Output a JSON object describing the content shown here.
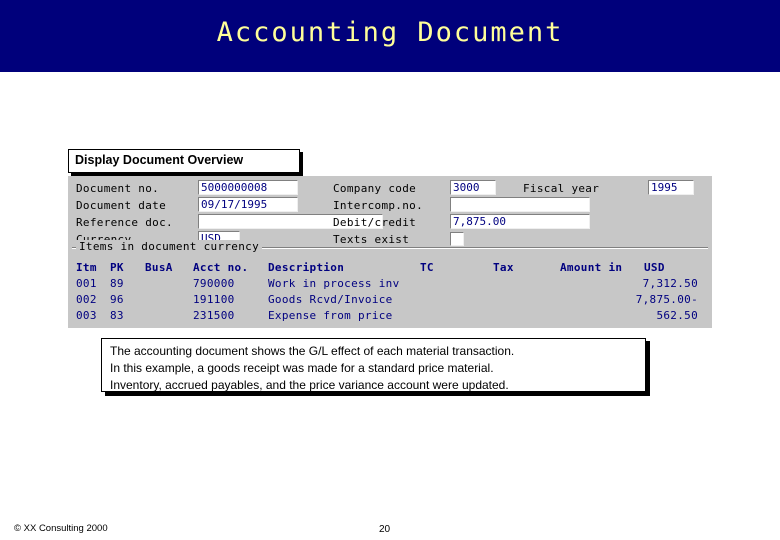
{
  "slide": {
    "title": "Accounting Document",
    "overview_label": "Display Document Overview"
  },
  "sap_screen": {
    "fields": [
      {
        "label": "Document  no.",
        "value": "5000000008"
      },
      {
        "label": "Document  date",
        "value": "09/17/1995"
      },
      {
        "label": "Reference  doc.",
        "value": ""
      },
      {
        "label": "Currency",
        "value": "USD"
      },
      {
        "label": "Company  code",
        "value": "3000"
      },
      {
        "label": "Fiscal  year",
        "value": "1995"
      },
      {
        "label": "Intercomp.no.",
        "value": ""
      },
      {
        "label": "Debit/credit",
        "value": "7,875.00"
      },
      {
        "label": "Texts  exist",
        "value": ""
      }
    ],
    "group_title": "Items  in  document  currency",
    "columns": [
      "Itm",
      "PK",
      "BusA",
      "Acct  no.",
      "Description",
      "TC",
      "Tax",
      "Amount  in",
      "USD"
    ],
    "rows": [
      {
        "itm": "001",
        "pk": "89",
        "busa": "",
        "acct": "790000",
        "description": "Work  in  process  inv",
        "tc": "",
        "tax": "",
        "amount": "7,312.50"
      },
      {
        "itm": "002",
        "pk": "96",
        "busa": "",
        "acct": "191100",
        "description": "Goods  Rcvd/Invoice",
        "tc": "",
        "tax": "",
        "amount": "7,875.00-"
      },
      {
        "itm": "003",
        "pk": "83",
        "busa": "",
        "acct": "231500",
        "description": "Expense  from  price",
        "tc": "",
        "tax": "",
        "amount": "562.50"
      }
    ]
  },
  "note": {
    "line1": "The accounting document shows the G/L effect of each material transaction.",
    "line2": "In this example, a goods receipt was made for a standard price material.",
    "line3": "Inventory, accrued payables, and the price variance account were updated."
  },
  "footer": {
    "copyright": "© XX  Consulting 2000",
    "page": "20"
  },
  "colors": {
    "banner": "#00007b",
    "title_text": "#ffff99",
    "sap_bg": "#c7c7c7",
    "sap_text": "#000080"
  }
}
